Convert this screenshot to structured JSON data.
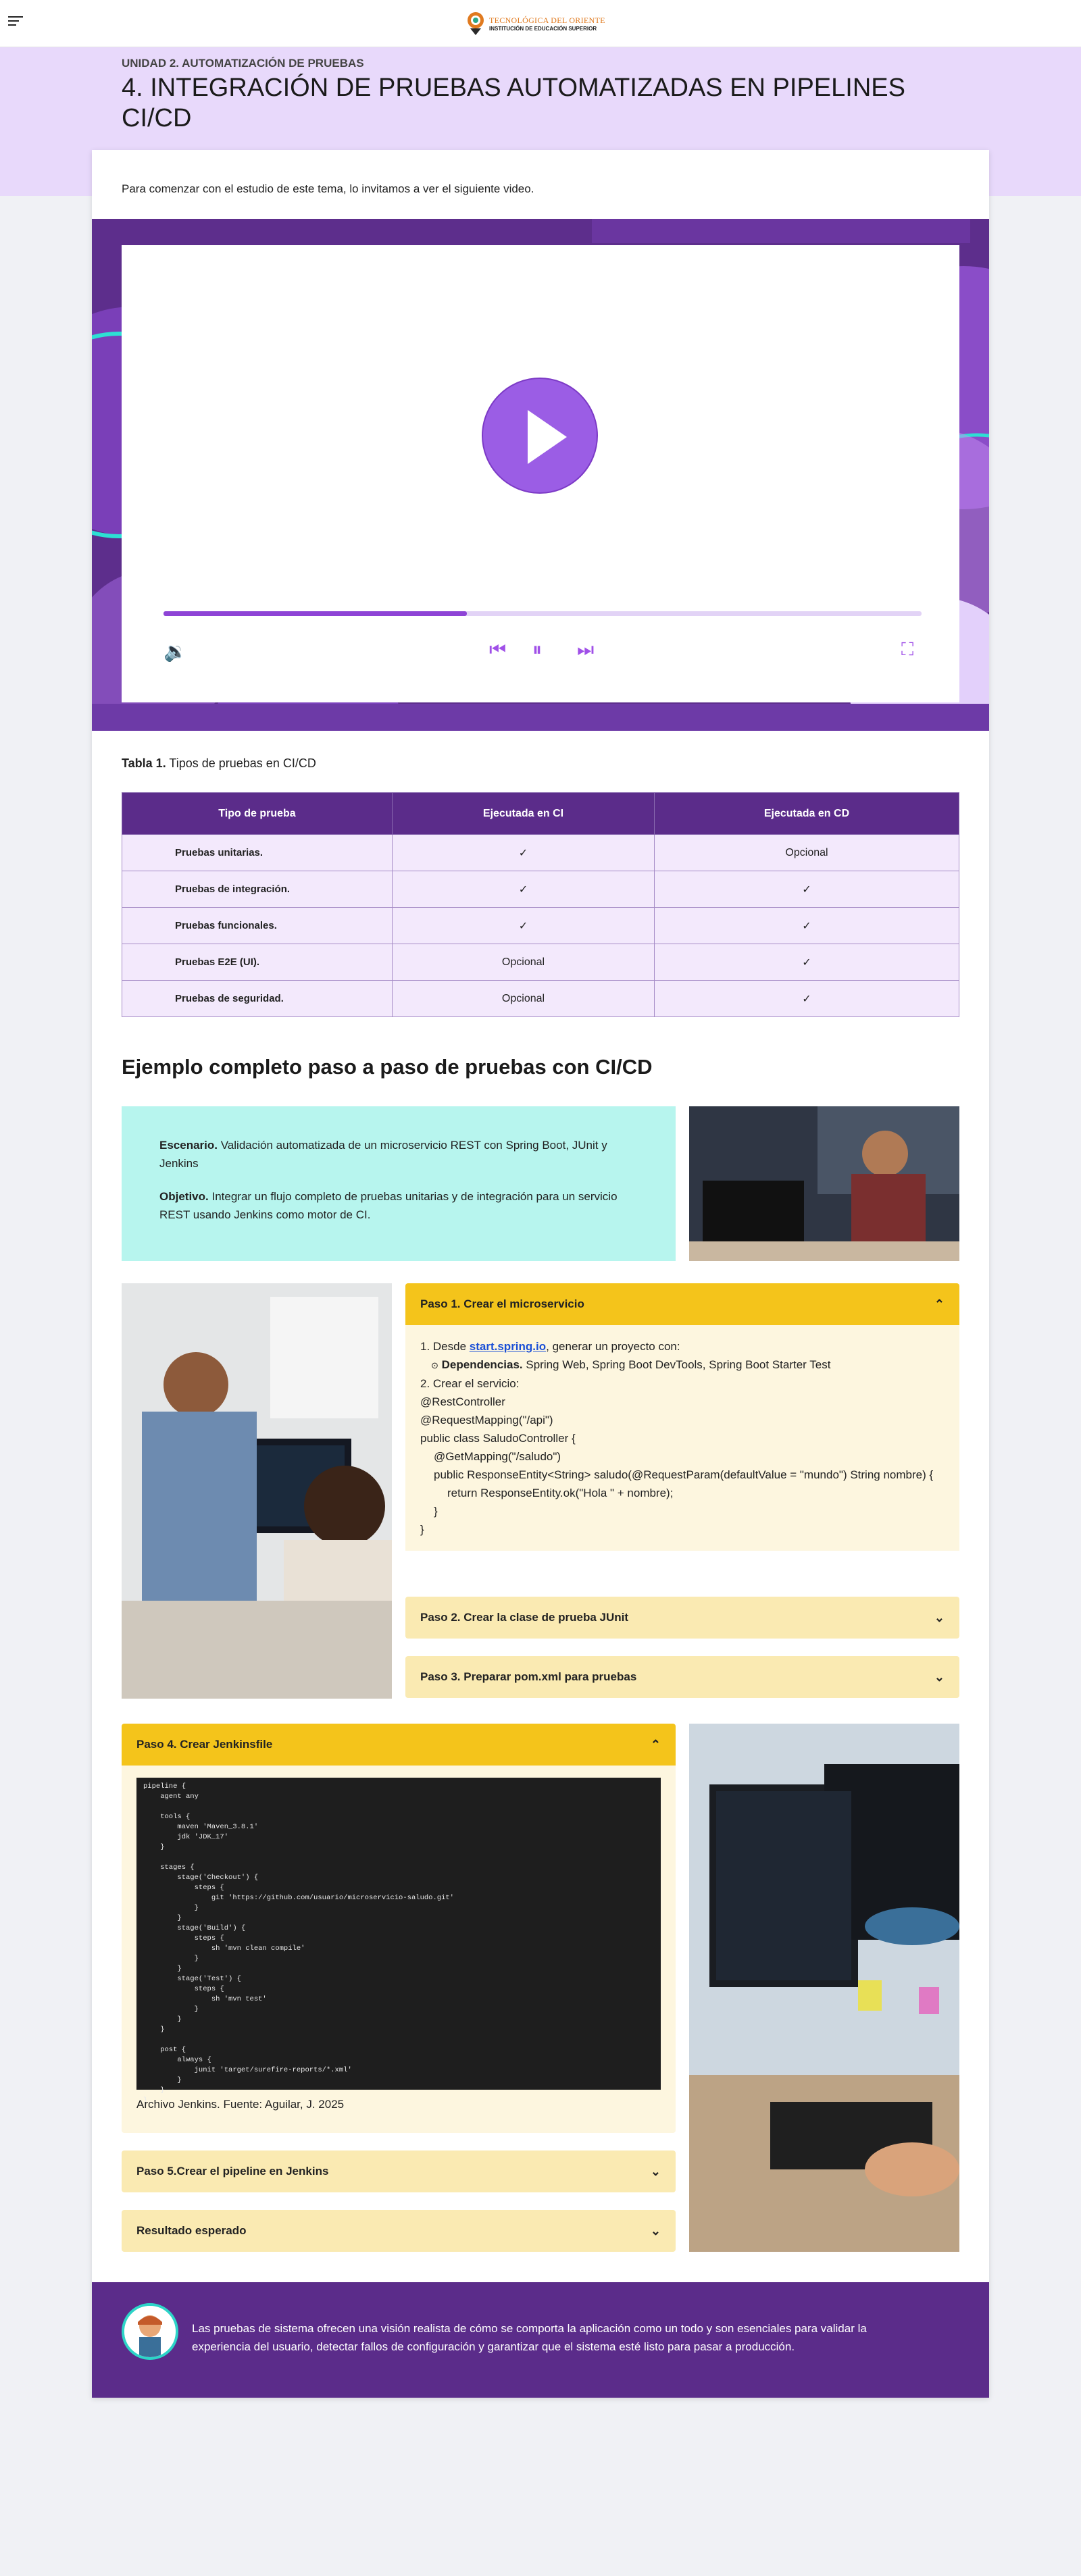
{
  "header": {
    "logo_title": "TECNOLÓGICA DEL ORIENTE",
    "logo_subtitle": "INSTITUCIÓN DE EDUCACIÓN SUPERIOR"
  },
  "hero": {
    "unit": "UNIDAD 2. AUTOMATIZACIÓN DE PRUEBAS",
    "title": "4. INTEGRACIÓN DE PRUEBAS AUTOMATIZADAS EN PIPELINES CI/CD"
  },
  "intro": "Para comenzar con el estudio de este tema, lo invitamos a ver el siguiente video.",
  "video": {
    "progress": 0.4,
    "colors": {
      "accent": "#9b5de5",
      "banner": "#5d2e8c"
    }
  },
  "table": {
    "caption_bold": "Tabla 1.",
    "caption": "Tipos de pruebas en CI/CD",
    "headers": [
      "Tipo de prueba",
      "Ejecutada en CI",
      "Ejecutada en CD"
    ],
    "rows": [
      [
        "Pruebas unitarias.",
        "✓",
        "Opcional"
      ],
      [
        "Pruebas de integración.",
        "✓",
        "✓"
      ],
      [
        "Pruebas funcionales.",
        "✓",
        "✓"
      ],
      [
        "Pruebas E2E (UI).",
        "Opcional",
        "✓"
      ],
      [
        "Pruebas de seguridad.",
        "Opcional",
        "✓"
      ]
    ]
  },
  "section_title": "Ejemplo completo paso a paso de pruebas con CI/CD",
  "scenario": {
    "label": "Escenario.",
    "text": "Validación automatizada de un microservicio REST con Spring Boot, JUnit y Jenkins",
    "objective_label": "Objetivo.",
    "objective_text": "Integrar un flujo completo de pruebas unitarias y de integración para un servicio REST usando Jenkins como motor de CI."
  },
  "accordion1": {
    "step1_title": "Paso 1. Crear el microservicio",
    "item1_prefix": "1. Desde",
    "item1_link": "start.spring.io",
    "item1_suffix": ", generar un proyecto con:",
    "deps_label": "Dependencias.",
    "deps_text": "Spring Web, Spring Boot DevTools, Spring Boot Starter Test",
    "item2": "2. Crear el servicio:",
    "code_lines": [
      "@RestController",
      "@RequestMapping(\"/api\")",
      "public class SaludoController {",
      "@GetMapping(\"/saludo\")",
      "public ResponseEntity<String> saludo(@RequestParam(defaultValue = \"mundo\") String nombre) {",
      "return ResponseEntity.ok(\"Hola \" + nombre);",
      "}",
      "}"
    ],
    "step2_title": "Paso 2. Crear la clase de prueba JUnit",
    "step3_title": "Paso 3. Preparar pom.xml para pruebas"
  },
  "accordion2": {
    "step4_title": "Paso 4. Crear Jenkinsfile",
    "jenkinsfile": "pipeline {\n    agent any\n\n    tools {\n        maven 'Maven_3.8.1'\n        jdk 'JDK_17'\n    }\n\n    stages {\n        stage('Checkout') {\n            steps {\n                git 'https://github.com/usuario/microservicio-saludo.git'\n            }\n        }\n        stage('Build') {\n            steps {\n                sh 'mvn clean compile'\n            }\n        }\n        stage('Test') {\n            steps {\n                sh 'mvn test'\n            }\n        }\n    }\n\n    post {\n        always {\n            junit 'target/surefire-reports/*.xml'\n        }\n    }\n}",
    "caption": "Archivo Jenkins. Fuente: Aguilar, J. 2025",
    "step5_title": "Paso 5.Crear el pipeline en Jenkins",
    "result_title": "Resultado esperado"
  },
  "footer": {
    "text": "Las pruebas de sistema ofrecen una visión realista de cómo se comporta la aplicación como un todo y son esenciales para validar la experiencia del usuario, detectar fallos de configuración y garantizar que el sistema esté listo para pasar a producción."
  }
}
